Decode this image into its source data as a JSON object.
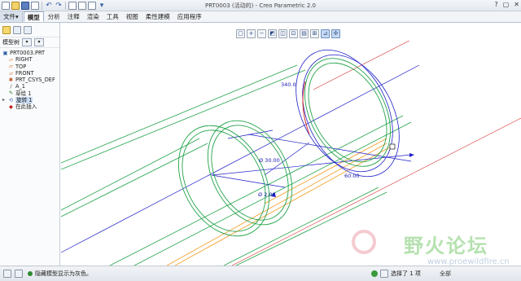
{
  "window": {
    "title": "PRT0003 (活动的) - Creo Parametric 2.0",
    "controls": [
      "?",
      "▢",
      "✕"
    ]
  },
  "tabs": [
    "文件▾",
    "模型",
    "分析",
    "注释",
    "渲染",
    "工具",
    "视图",
    "柔性建模",
    "应用程序"
  ],
  "tree": {
    "header_label": "模型树",
    "items": [
      {
        "label": "PRT0003.PRT",
        "icon": "part-icon"
      },
      {
        "label": "RIGHT",
        "icon": "datum-plane-icon"
      },
      {
        "label": "TOP",
        "icon": "datum-plane-icon"
      },
      {
        "label": "FRONT",
        "icon": "datum-plane-icon"
      },
      {
        "label": "PRT_CSYS_DEF",
        "icon": "csys-icon"
      },
      {
        "label": "A_1",
        "icon": "axis-icon"
      },
      {
        "label": "草绘 1",
        "icon": "sketch-icon"
      },
      {
        "label": "旋转 1",
        "icon": "revolve-icon"
      },
      {
        "label": "在此插入",
        "icon": "insert-here-icon"
      }
    ]
  },
  "dimensions": {
    "d1": "340.0",
    "d2": "Ø 30.00",
    "d3": "Ø 2.00",
    "d4": "60.00"
  },
  "status": {
    "message": "隐藏模型显示为灰色。",
    "selection": "选择了 1 项",
    "filter": "全部"
  },
  "watermark": {
    "text": "野火论坛",
    "url": "www.proewildfire.cn"
  },
  "colors": {
    "sketch_green": "#22a34a",
    "dim_blue": "#1f1fc8",
    "orange": "#f29a1e",
    "red": "#d42a2a"
  }
}
